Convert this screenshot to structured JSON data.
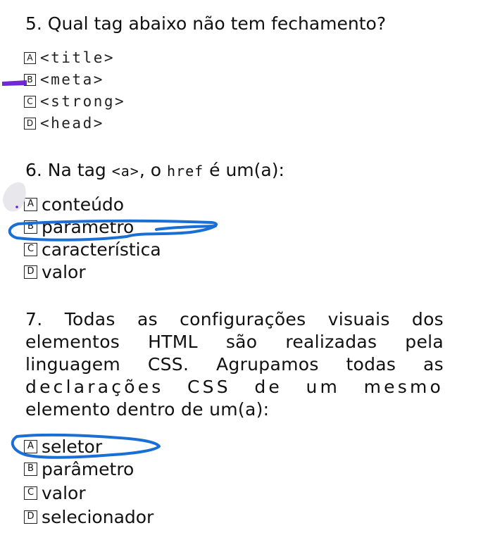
{
  "q5": {
    "question": "5. Qual tag abaixo não tem fechamento?",
    "options": [
      {
        "letter": "A",
        "text": "<title>"
      },
      {
        "letter": "B",
        "text": "<meta>"
      },
      {
        "letter": "C",
        "text": "<strong>"
      },
      {
        "letter": "D",
        "text": "<head>"
      }
    ]
  },
  "q6": {
    "prefix": "6. Na tag",
    "code1": "<a>",
    "middle": ", o",
    "code2": "href",
    "suffix": "é um(a):",
    "options": [
      {
        "letter": "A",
        "text": "conteúdo"
      },
      {
        "letter": "B",
        "text": "parametro"
      },
      {
        "letter": "C",
        "text": "característica"
      },
      {
        "letter": "D",
        "text": "valor"
      }
    ]
  },
  "q7": {
    "lines": [
      "7. Todas as configurações visuais dos",
      "elementos HTML são realizadas pela",
      "linguagem CSS. Agrupamos todas as",
      "declarações CSS de um mesmo",
      "elemento dentro de um(a):"
    ],
    "options": [
      {
        "letter": "A",
        "text": "seletor"
      },
      {
        "letter": "B",
        "text": "parâmetro"
      },
      {
        "letter": "C",
        "text": "valor"
      },
      {
        "letter": "D",
        "text": "selecionador"
      }
    ]
  },
  "annotations": {
    "ink_blue": "#1a6fd6",
    "highlighter_purple": "#6a1bd6"
  }
}
